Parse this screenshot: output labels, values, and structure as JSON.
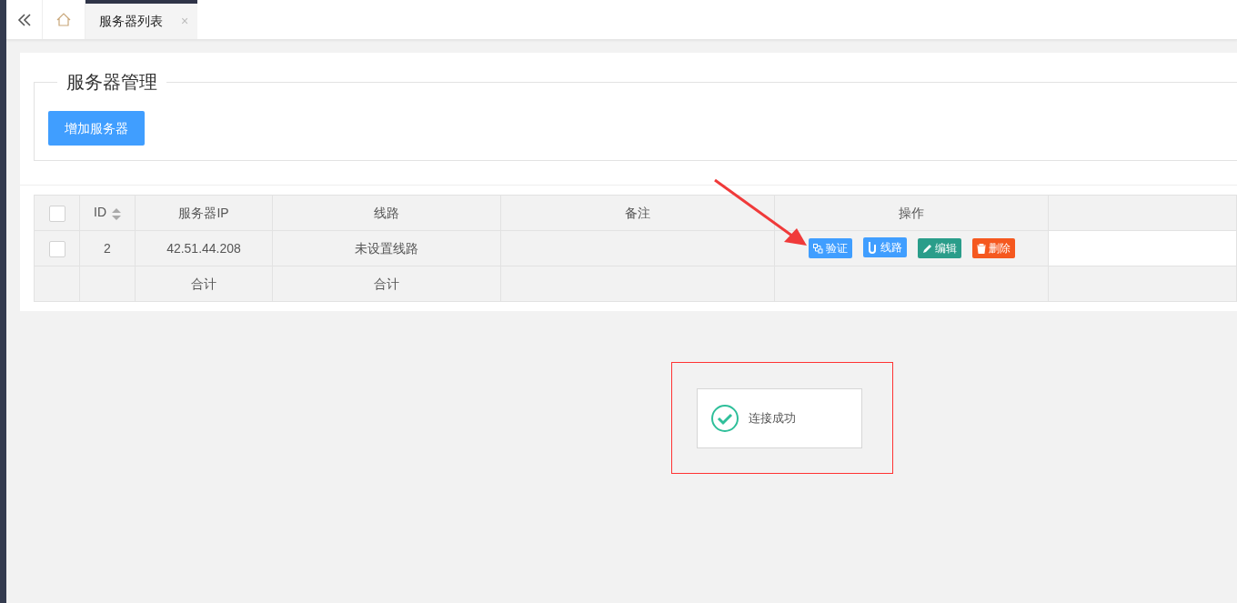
{
  "tabs": [
    {
      "label": "服务器列表",
      "selected": true,
      "close": "×"
    }
  ],
  "panel": {
    "legend": "服务器管理",
    "add_button": "增加服务器"
  },
  "table": {
    "header_checkbox": {
      "checked": false
    },
    "columns": [
      {
        "label": "ID",
        "sortable": true
      },
      {
        "label": "服务器IP",
        "sortable": false
      },
      {
        "label": "线路",
        "sortable": false
      },
      {
        "label": "备注",
        "sortable": false
      },
      {
        "label": "操作",
        "sortable": false
      }
    ],
    "rows": [
      {
        "checked": false,
        "id": "2",
        "ip": "42.51.44.208",
        "line": "未设置线路",
        "actions": [
          {
            "kind": "verify",
            "label": "验证"
          },
          {
            "kind": "line",
            "label": "线路"
          },
          {
            "kind": "edit",
            "label": "编辑"
          },
          {
            "kind": "delete",
            "label": "删除"
          }
        ]
      }
    ],
    "footer": {
      "ip": "合计",
      "line": "合计"
    }
  },
  "toast": {
    "message": "连接成功"
  }
}
